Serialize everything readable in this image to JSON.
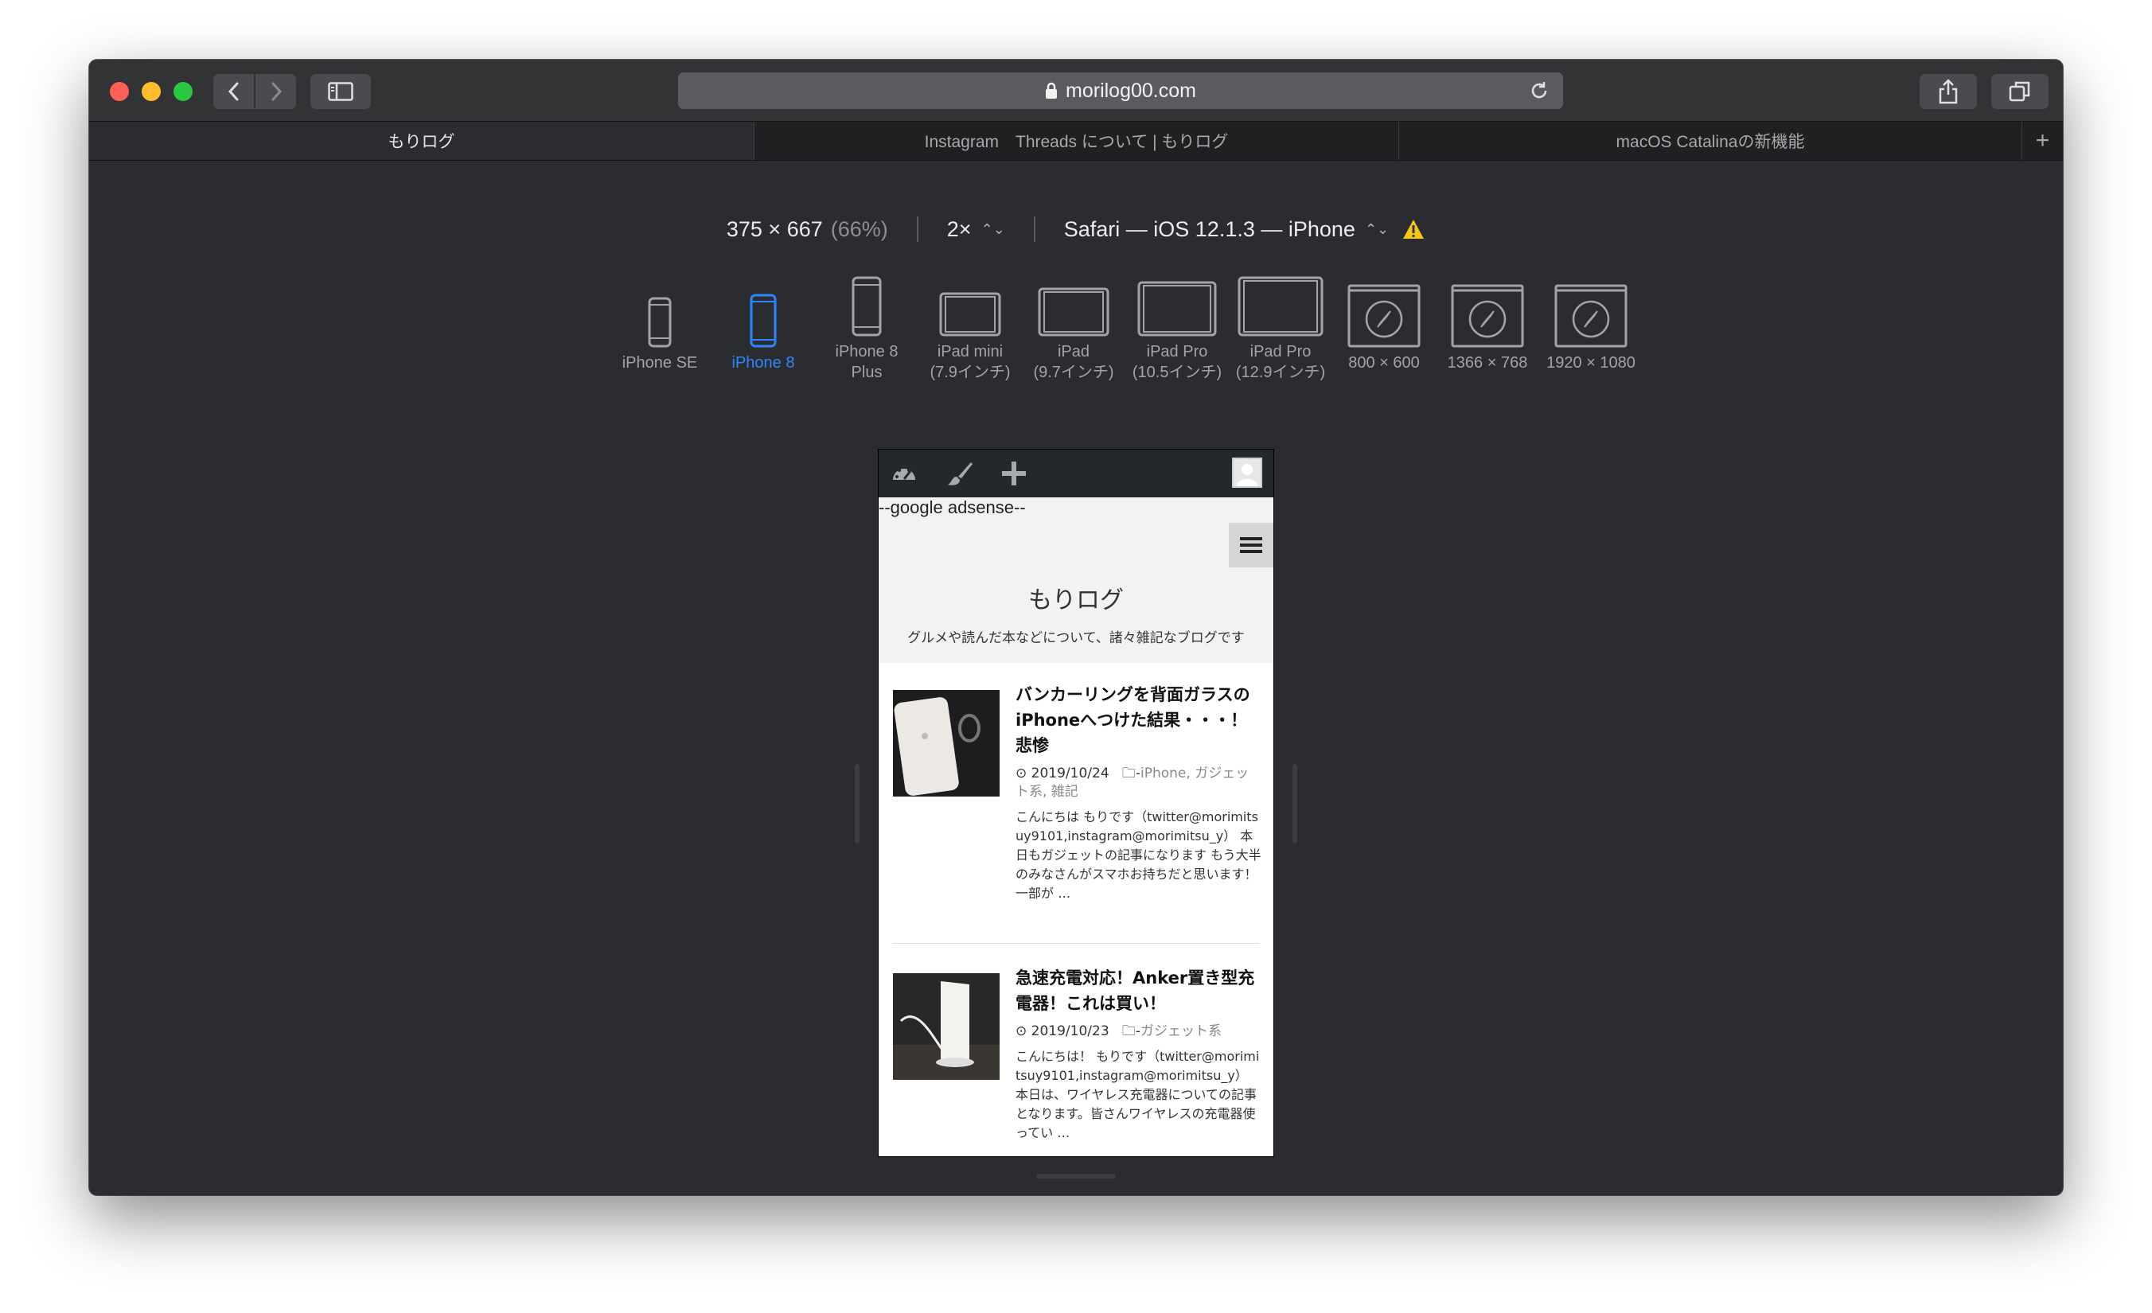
{
  "browser": {
    "url": "morilog00.com",
    "tabs": [
      {
        "label": "もりログ",
        "active": true
      },
      {
        "label": "Instagram　Threads について | もりログ",
        "active": false
      },
      {
        "label": "macOS Catalinaの新機能",
        "active": false
      }
    ],
    "new_tab": "+"
  },
  "responsive": {
    "dimensions": "375 × 667",
    "scale_pct": "(66%)",
    "pixel_ratio": "2×",
    "user_agent": "Safari — iOS 12.1.3 — iPhone",
    "devices": [
      {
        "label1": "iPhone SE",
        "label2": ""
      },
      {
        "label1": "iPhone 8",
        "label2": "",
        "selected": true
      },
      {
        "label1": "iPhone 8",
        "label2": "Plus"
      },
      {
        "label1": "iPad mini",
        "label2": "(7.9インチ)"
      },
      {
        "label1": "iPad",
        "label2": "(9.7インチ)"
      },
      {
        "label1": "iPad Pro",
        "label2": "(10.5インチ)"
      },
      {
        "label1": "iPad Pro",
        "label2": "(12.9インチ)"
      },
      {
        "label1": "800 × 600",
        "label2": ""
      },
      {
        "label1": "1366 × 768",
        "label2": ""
      },
      {
        "label1": "1920 × 1080",
        "label2": ""
      }
    ]
  },
  "site": {
    "adsense": "--google adsense--",
    "title": "もりログ",
    "tagline": "グルメや読んだ本などについて、諸々雑記なブログです",
    "posts": [
      {
        "title": "バンカーリングを背面ガラスのiPhoneへつけた結果・・・！悲惨",
        "date": "2019/10/24",
        "categories": "iPhone, ガジェット系, 雑記",
        "excerpt": "こんにちは もりです（twitter@morimitsuy9101,instagram@morimitsu_y） 本日もガジェットの記事になります もう大半のみなさんがスマホお持ちだと思います！一部が …"
      },
      {
        "title": "急速充電対応！Anker置き型充電器！これは買い！",
        "date": "2019/10/23",
        "categories": "ガジェット系",
        "excerpt": "こんにちは！ もりです（twitter@morimitsuy9101,instagram@morimitsu_y） 本日は、ワイヤレス充電器についての記事となります。皆さんワイヤレスの充電器使ってい …"
      }
    ]
  },
  "colors": {
    "window_bg": "#2b2c2f",
    "selected_device": "#2d86ff",
    "wp_admin_bar": "#23282d"
  }
}
